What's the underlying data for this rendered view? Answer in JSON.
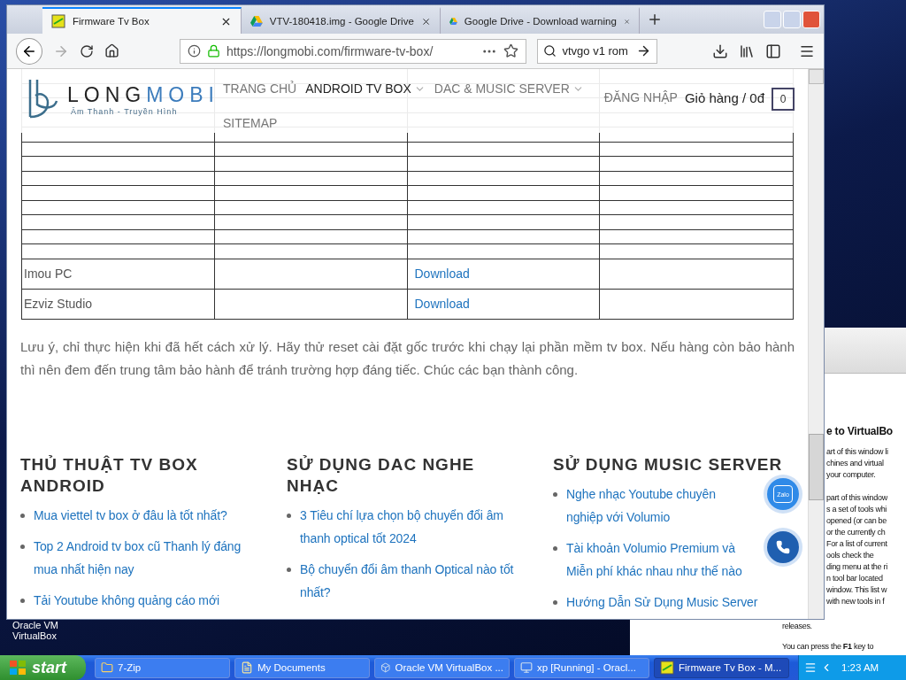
{
  "browser": {
    "tabs": [
      {
        "label": "Firmware Tv Box",
        "selected": true,
        "kind": "site"
      },
      {
        "label": "VTV-180418.img - Google Drive",
        "selected": false,
        "kind": "drive"
      },
      {
        "label": "Google Drive - Download warning",
        "selected": false,
        "kind": "drive"
      }
    ],
    "url": "https://longmobi.com/firmware-tv-box/",
    "search": "vtvgo v1 rom"
  },
  "site": {
    "logo": {
      "word_1": "LONG",
      "word_2": "MOBI",
      "tagline": "Âm Thanh - Truyền Hình"
    },
    "nav": [
      {
        "label": "TRANG CHỦ",
        "selected": false,
        "dropdown": false
      },
      {
        "label": "ANDROID TV BOX",
        "selected": true,
        "dropdown": true
      },
      {
        "label": "DAC & MUSIC SERVER",
        "selected": false,
        "dropdown": true
      },
      {
        "label": "SITEMAP",
        "selected": false,
        "dropdown": false
      }
    ],
    "login": "ĐĂNG NHẬP",
    "cart": "Giỏ hàng / 0đ",
    "cart_count": "0"
  },
  "table": {
    "rows": [
      {
        "name": "Imou PC",
        "link": "Download"
      },
      {
        "name": "Ezviz Studio",
        "link": "Download"
      }
    ]
  },
  "note": "Lưu ý, chỉ thực hiện khi đã hết cách xử lý. Hãy thử reset cài đặt gốc trước khi chạy lại phần mềm tv box. Nếu hàng còn bảo hành thì nên đem đến trung tâm bảo hành để tránh trường hợp đáng tiếc. Chúc các bạn thành công.",
  "footer": [
    {
      "title": "THỦ THUẬT TV BOX ANDROID",
      "links": [
        "Mua viettel tv box ở đâu là tốt nhất?",
        "Top 2 Android tv box cũ Thanh lý đáng mua nhất hiện nay",
        "Tải Youtube không quảng cáo mới"
      ]
    },
    {
      "title": "SỬ DỤNG DAC NGHE NHẠC",
      "links": [
        "3 Tiêu chí lựa chọn bộ chuyển đổi âm thanh optical tốt 2024",
        "Bộ chuyển đổi âm thanh Optical nào tốt nhất?"
      ]
    },
    {
      "title": "SỬ DỤNG MUSIC SERVER",
      "links": [
        "Nghe nhạc Youtube chuyên nghiệp với Volumio",
        "Tài khoản Volumio Premium và Miễn phí khác nhau như thế nào",
        "Hướng Dẫn Sử Dụng Music Server"
      ]
    }
  ],
  "floating": {
    "zalo": "Zalo"
  },
  "virtualbox": {
    "heading": "e to VirtualBo",
    "paragraphs": [
      [
        "art of this window li",
        "chines and virtual",
        "your computer."
      ],
      [
        "part of this window",
        "s a set of tools whi",
        "opened (or can be",
        "or the currently ch",
        "For a list of current",
        "ools check the",
        "ding menu at the ri",
        "n tool bar located",
        "window. This list w",
        "with new tools in f"
      ]
    ],
    "tail": "releases.",
    "hint": "You can press the **F1** key to"
  },
  "desktop_icon": {
    "line_1": "Oracle VM",
    "line_2": "VirtualBox"
  },
  "taskbar": {
    "start": "start",
    "items": [
      {
        "label": "7-Zip",
        "kind": "folder",
        "selected": false
      },
      {
        "label": "My Documents",
        "kind": "documents",
        "selected": false
      },
      {
        "label": "Oracle VM VirtualBox ...",
        "kind": "cube",
        "selected": false
      },
      {
        "label": "xp [Running] - Oracl...",
        "kind": "vm",
        "selected": false
      },
      {
        "label": "Firmware Tv Box - M...",
        "kind": "site",
        "selected": true
      }
    ],
    "time": "1:23 AM"
  }
}
